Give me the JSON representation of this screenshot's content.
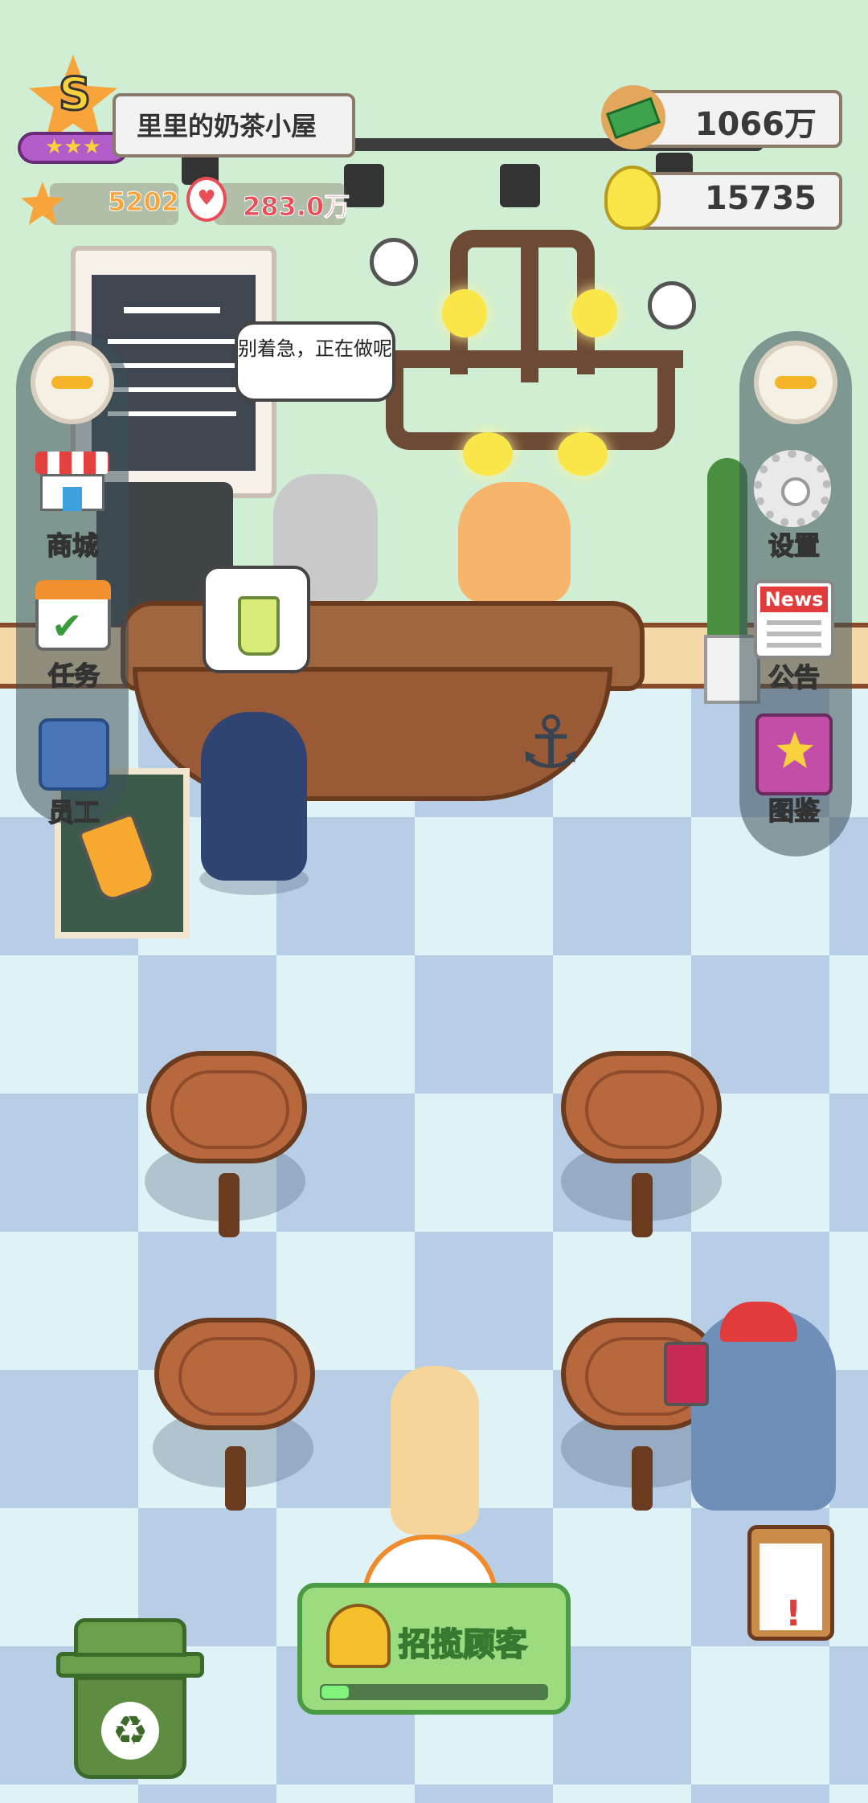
{
  "shop": {
    "rank_letter": "S",
    "name": "里里的奶茶小屋",
    "stars": "5202",
    "popularity": "283.0万"
  },
  "currency": {
    "money": "1066万",
    "ideas": "15735"
  },
  "speech_bubble": "别着急，正在做呢",
  "left_menu": {
    "shop": "商城",
    "tasks": "任务",
    "staff": "员工"
  },
  "right_menu": {
    "settings": "设置",
    "news_badge": "News",
    "notice": "公告",
    "collection": "图鉴"
  },
  "recruit": {
    "label": "招揽顾客",
    "progress": 0.12
  },
  "colors": {
    "wall": "#cfeed4",
    "floor_dark": "#b8cee6",
    "floor_light": "#dff3f7",
    "recruit_green": "#9ddc7e"
  }
}
